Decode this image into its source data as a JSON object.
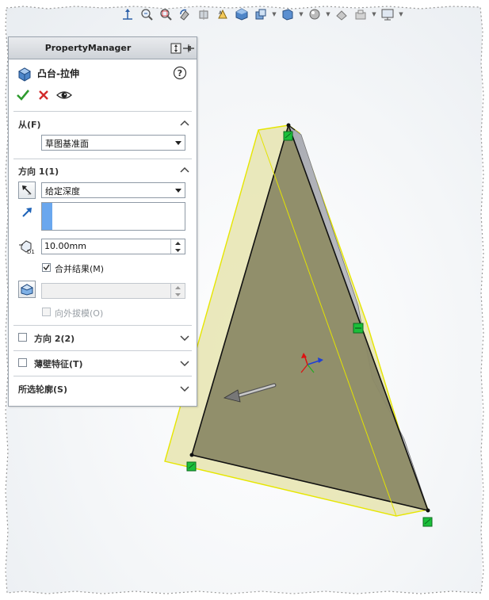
{
  "property_manager": {
    "header_title": "PropertyManager",
    "feature_title": "凸台-拉伸",
    "icons": {
      "header": "pin-icon",
      "feature": "boss-extrude-icon",
      "help": "help-icon",
      "ok": "checkmark-icon",
      "cancel": "close-icon",
      "preview": "eye-icon"
    },
    "from_group": {
      "title": "从(F)",
      "selected": "草图基准面"
    },
    "direction1": {
      "title": "方向 1(1)",
      "end_condition": "给定深度",
      "depth": "10.00mm",
      "merge_result_label": "合并结果(M)",
      "merge_result_checked": true,
      "draft_value": "",
      "draft_outward_label": "向外拔模(O)",
      "draft_outward_checked": false
    },
    "collapsed_groups": [
      {
        "title": "方向 2(2)",
        "checked": false
      },
      {
        "title": "薄壁特征(T)",
        "checked": false
      },
      {
        "title": "所选轮廓(S)"
      }
    ]
  },
  "hud_toolbar": {
    "icons": [
      "view-orientation-icon",
      "zoom-to-fit-icon",
      "zoom-to-area-icon",
      "previous-view-icon",
      "section-view-icon",
      "dynamic-annotation-icon",
      "view-orientation-cube-icon",
      "display-style-icon",
      "hide-show-icon",
      "edit-appearance-icon",
      "apply-scene-icon",
      "view-settings-icon",
      "display-icon"
    ]
  },
  "colors": {
    "accept": "#2e9b2e",
    "cancel": "#d22b2b",
    "preview_fill": "#8c8a66",
    "extrude_face": "#d8d59a",
    "selection_edge": "#e3e300",
    "handle": "#1bbf3a"
  }
}
